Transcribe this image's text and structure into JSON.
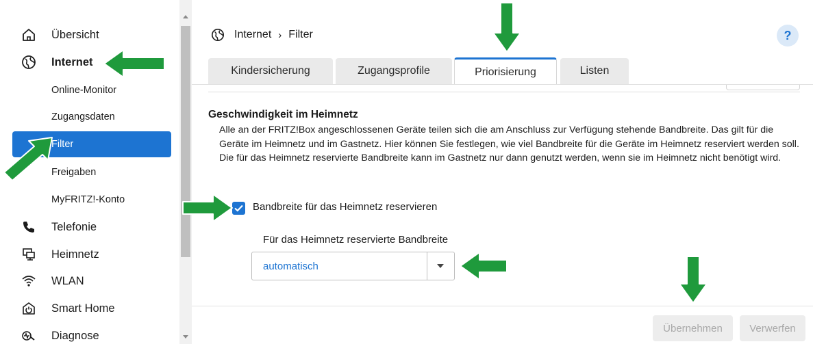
{
  "sidebar": {
    "items": [
      {
        "key": "uebersicht",
        "label": "Übersicht",
        "icon": "home-icon"
      },
      {
        "key": "internet",
        "label": "Internet",
        "icon": "globe-icon",
        "expanded": true
      },
      {
        "key": "telefonie",
        "label": "Telefonie",
        "icon": "phone-icon"
      },
      {
        "key": "heimnetz",
        "label": "Heimnetz",
        "icon": "network-icon"
      },
      {
        "key": "wlan",
        "label": "WLAN",
        "icon": "wifi-icon"
      },
      {
        "key": "smarthome",
        "label": "Smart Home",
        "icon": "smart-home-icon"
      },
      {
        "key": "diagnose",
        "label": "Diagnose",
        "icon": "diagnose-icon"
      }
    ],
    "subitems": [
      {
        "label": "Online-Monitor"
      },
      {
        "label": "Zugangsdaten"
      },
      {
        "label": "Filter",
        "active": true
      },
      {
        "label": "Freigaben"
      },
      {
        "label": "MyFRITZ!-Konto"
      }
    ]
  },
  "header": {
    "breadcrumb": [
      "Internet",
      "Filter"
    ],
    "breadcrumb_sep": "›",
    "help_label": "?"
  },
  "tabs": [
    {
      "label": "Kindersicherung"
    },
    {
      "label": "Zugangsprofile"
    },
    {
      "label": "Priorisierung",
      "active": true
    },
    {
      "label": "Listen"
    }
  ],
  "content": {
    "heading": "Geschwindigkeit im Heimnetz",
    "description": "Alle an der FRITZ!Box angeschlossenen Geräte teilen sich die am Anschluss zur Verfügung stehende Bandbreite. Das gilt für die Geräte im Heimnetz und im Gastnetz. Hier können Sie festlegen, wie viel Bandbreite für die Geräte im Heimnetz reserviert werden soll. Die für das Heimnetz reservierte Bandbreite kann im Gastnetz nur dann genutzt werden, wenn sie im Heimnetz nicht benötigt wird.",
    "checkbox_label": "Bandbreite für das Heimnetz reservieren",
    "checkbox_checked": true,
    "select_label": "Für das Heimnetz reservierte Bandbreite",
    "select_value": "automatisch"
  },
  "footer": {
    "apply_label": "Übernehmen",
    "discard_label": "Verwerfen"
  },
  "colors": {
    "accent": "#1d74d2",
    "arrow": "#1f9a3c"
  }
}
